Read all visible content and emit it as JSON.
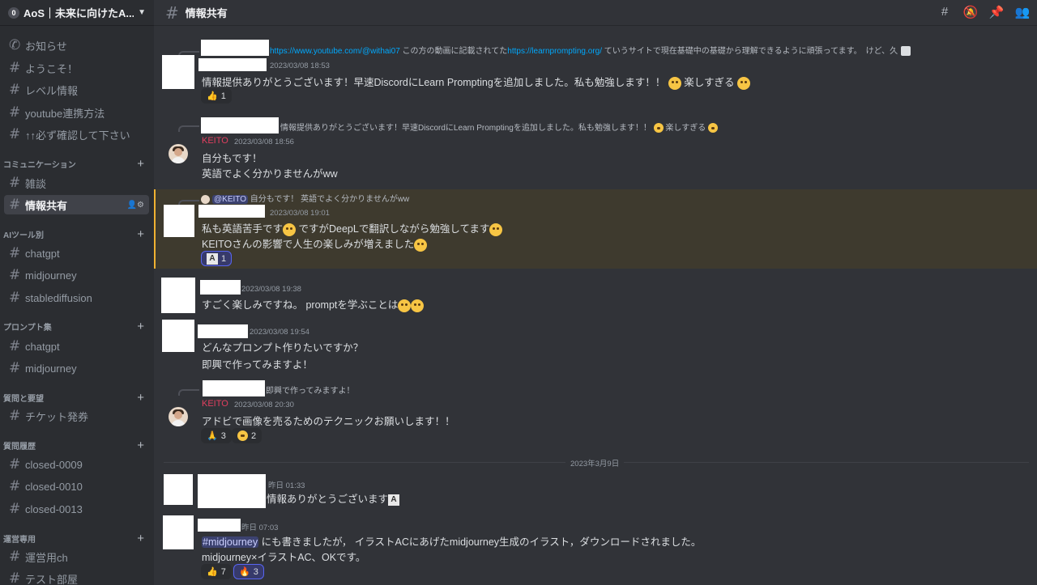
{
  "server": {
    "badge": "0",
    "name": "AoS｜未来に向けたA..."
  },
  "channel": {
    "title": "情報共有"
  },
  "sidebar": {
    "channels_top": [
      {
        "name": "お知らせ",
        "icon": "megaphone-icon"
      },
      {
        "name": "ようこそ！",
        "icon": "hash-icon"
      },
      {
        "name": "レベル情報",
        "icon": "hash-icon"
      },
      {
        "name": "youtube連携方法",
        "icon": "hash-icon"
      },
      {
        "name": "↑↑必ず確認して下さい",
        "icon": "hash-icon"
      }
    ],
    "categories": [
      {
        "title": "コミュニケーション",
        "channels": [
          "雑談",
          "情報共有"
        ]
      },
      {
        "title": "AIツール別",
        "channels": [
          "chatgpt",
          "midjourney",
          "stablediffusion"
        ]
      },
      {
        "title": "プロンプト集",
        "channels": [
          "chatgpt",
          "midjourney"
        ]
      },
      {
        "title": "質問と要望",
        "channels": [
          "チケット発券"
        ]
      },
      {
        "title": "質問履歴",
        "channels": [
          "closed-0009",
          "closed-0010",
          "closed-0013"
        ]
      },
      {
        "title": "運営専用",
        "channels": [
          "運営用ch",
          "テスト部屋"
        ]
      }
    ]
  },
  "messages": {
    "m1": {
      "reply_link1": "https://www.youtube.com/@withai07",
      "reply_mid": " この方の動画に記載されてた",
      "reply_link2": "https://learnprompting.org/",
      "reply_tail": "  ていうサイトで現在基礎中の基礎から理解できるように頑張ってます。　けど、久",
      "time": "2023/03/08 18:53",
      "text": "情報提供ありがとうございます！早速DiscordにLearn Promptingを追加しました。私も勉強します！！",
      "text_tail": "楽しすぎる",
      "reaction_count": "1"
    },
    "m2": {
      "reply_text": "情報提供ありがとうございます！早速DiscordにLearn Promptingを追加しました。私も勉強します！！",
      "reply_tail": "楽しすぎる",
      "author": "KEITO",
      "time": "2023/03/08 18:56",
      "line1": "自分もです！",
      "line2": "英語でよく分かりませんがww"
    },
    "m3": {
      "reply_mention": "@KEITO",
      "reply_text": " 自分もです！ 英語でよく分かりませんがww",
      "time": "2023/03/08 19:01",
      "line1a": "私も英語苦手です",
      "line1b": "ですがDeepLで翻訳しながら勉強してます",
      "line2": "KEITOさんの影響で人生の楽しみが増えました",
      "reaction_count": "1"
    },
    "m4": {
      "time": "2023/03/08 19:38",
      "text": "すごく楽しみですね。 promptを学ぶことは"
    },
    "m5": {
      "time": "2023/03/08 19:54",
      "line1": "どんなプロンプト作りたいですか？",
      "line2": "即興で作ってみますよ！"
    },
    "m6": {
      "reply_text": "即興で作ってみますよ！",
      "author": "KEITO",
      "time": "2023/03/08 20:30",
      "text": "アドビで画像を売るためのテクニックお願いします！！",
      "reaction1_count": "3",
      "reaction2_count": "2"
    },
    "divider": "2023年3月9日",
    "m7": {
      "time": "昨日 01:33",
      "text": "情報ありがとうございます"
    },
    "m8": {
      "time": "昨日 07:03",
      "mention": "#midjourney",
      "line1": " にも書きましたが， イラストACにあげたmidjourney生成のイラスト，ダウンロードされました。",
      "line2": "midjourney×イラストAC、OKです。",
      "reaction1_count": "7",
      "reaction2_count": "3"
    }
  },
  "colors": {
    "background": "#313338",
    "sidebar": "#2b2d31",
    "author": "#e23f5f",
    "link": "#00a8fc",
    "highlight": "#f0b232"
  }
}
